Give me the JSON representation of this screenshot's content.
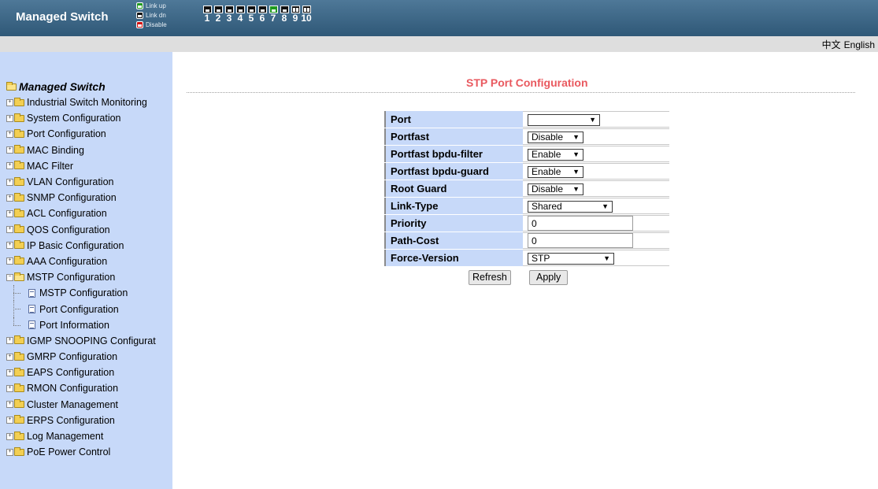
{
  "header": {
    "brand": "Managed Switch",
    "legend": [
      {
        "label": "Link up",
        "state": "up",
        "color": "#1f9a1f",
        "icon": "port-up-icon"
      },
      {
        "label": "Link dn",
        "state": "down",
        "color": "#111111",
        "icon": "port-down-icon"
      },
      {
        "label": "Disable",
        "state": "disable",
        "color": "#d01010",
        "icon": "port-disable-icon"
      }
    ],
    "ports": [
      {
        "num": "1",
        "state": "down"
      },
      {
        "num": "2",
        "state": "down"
      },
      {
        "num": "3",
        "state": "down"
      },
      {
        "num": "4",
        "state": "down"
      },
      {
        "num": "5",
        "state": "down"
      },
      {
        "num": "6",
        "state": "down"
      },
      {
        "num": "7",
        "state": "up"
      },
      {
        "num": "8",
        "state": "down"
      },
      {
        "num": "9",
        "state": "fiber"
      },
      {
        "num": "10",
        "state": "fiber"
      }
    ]
  },
  "lang": {
    "chinese": "中文",
    "english": "English"
  },
  "sidebar": {
    "root": "Managed Switch",
    "items": [
      {
        "label": "Industrial Switch Monitoring"
      },
      {
        "label": "System Configuration"
      },
      {
        "label": "Port Configuration"
      },
      {
        "label": "MAC Binding"
      },
      {
        "label": "MAC Filter"
      },
      {
        "label": "VLAN Configuration"
      },
      {
        "label": "SNMP Configuration"
      },
      {
        "label": "ACL Configuration"
      },
      {
        "label": "QOS Configuration"
      },
      {
        "label": "IP Basic Configuration"
      },
      {
        "label": "AAA Configuration"
      },
      {
        "label": "MSTP Configuration",
        "expanded": true,
        "children": [
          "MSTP Configuration",
          "Port Configuration",
          "Port Information"
        ]
      },
      {
        "label": "IGMP SNOOPING Configurat"
      },
      {
        "label": "GMRP Configuration"
      },
      {
        "label": "EAPS Configuration"
      },
      {
        "label": "RMON Configuration"
      },
      {
        "label": "Cluster Management"
      },
      {
        "label": "ERPS Configuration"
      },
      {
        "label": "Log Management"
      },
      {
        "label": "PoE Power Control"
      }
    ]
  },
  "main": {
    "title": "STP Port Configuration",
    "fields": {
      "port": {
        "label": "Port",
        "value": ""
      },
      "portfast": {
        "label": "Portfast",
        "value": "Disable"
      },
      "bpdu_filter": {
        "label": "Portfast bpdu-filter",
        "value": "Enable"
      },
      "bpdu_guard": {
        "label": "Portfast bpdu-guard",
        "value": "Enable"
      },
      "root_guard": {
        "label": "Root Guard",
        "value": "Disable"
      },
      "link_type": {
        "label": "Link-Type",
        "value": "Shared"
      },
      "priority": {
        "label": "Priority",
        "value": "0"
      },
      "path_cost": {
        "label": "Path-Cost",
        "value": "0"
      },
      "force_version": {
        "label": "Force-Version",
        "value": "STP"
      }
    },
    "buttons": {
      "refresh": "Refresh",
      "apply": "Apply"
    }
  }
}
